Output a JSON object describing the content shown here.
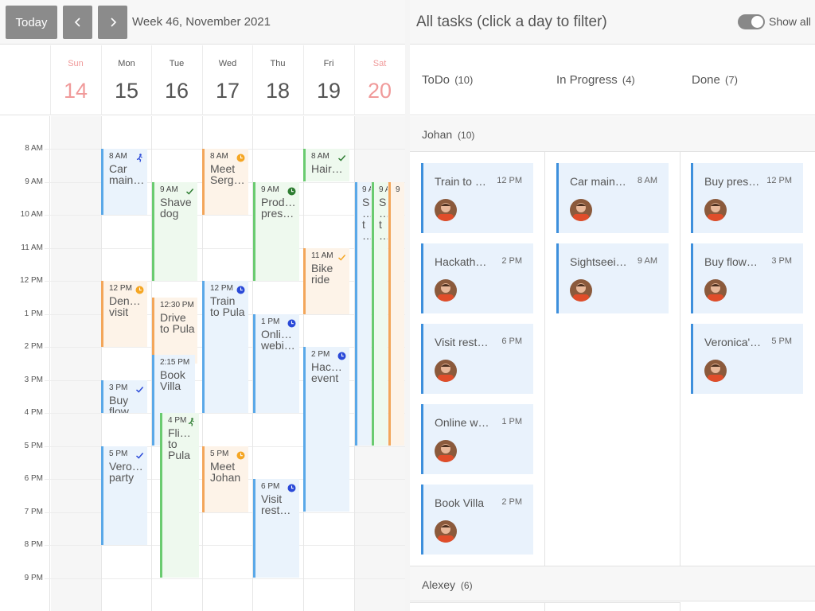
{
  "toolbar": {
    "today_label": "Today",
    "prev_icon": "chevron-left-icon",
    "next_icon": "chevron-right-icon",
    "week_label": "Week 46, November 2021"
  },
  "days": [
    {
      "name": "Sun",
      "num": "14",
      "weekend": true
    },
    {
      "name": "Mon",
      "num": "15",
      "weekend": false
    },
    {
      "name": "Tue",
      "num": "16",
      "weekend": false
    },
    {
      "name": "Wed",
      "num": "17",
      "weekend": false
    },
    {
      "name": "Thu",
      "num": "18",
      "weekend": false
    },
    {
      "name": "Fri",
      "num": "19",
      "weekend": false
    },
    {
      "name": "Sat",
      "num": "20",
      "weekend": true
    }
  ],
  "time_labels": [
    "8 AM",
    "9 AM",
    "10 AM",
    "11 AM",
    "12 PM",
    "1 PM",
    "2 PM",
    "3 PM",
    "4 PM",
    "5 PM",
    "6 PM",
    "7 PM",
    "8 PM",
    "9 PM"
  ],
  "events": {
    "mon_car": {
      "time": "8 AM",
      "title": "Car main…",
      "color": "blue",
      "icon": "running-icon"
    },
    "mon_dentist": {
      "time": "12 PM",
      "title": "Den… visit",
      "color": "orange",
      "icon": "clock-icon"
    },
    "mon_flowers": {
      "time": "3 PM",
      "title": "Buy flow…",
      "color": "blue",
      "icon": "check-icon"
    },
    "mon_party": {
      "time": "5 PM",
      "title": "Vero… party",
      "color": "blue",
      "icon": "check-icon"
    },
    "tue_shave": {
      "time": "9 AM",
      "title": "Shave dog",
      "color": "green",
      "icon": "check-icon"
    },
    "tue_drive": {
      "time": "12:30 PM",
      "title": "Drive to Pula",
      "color": "orange",
      "icon": ""
    },
    "tue_villa": {
      "time": "2:15 PM",
      "title": "Book Villa",
      "color": "blue",
      "icon": ""
    },
    "tue_flight": {
      "time": "4 PM",
      "title": "Fli… to Pula",
      "color": "green",
      "icon": "running-icon"
    },
    "wed_meet_serg": {
      "time": "8 AM",
      "title": "Meet Serg…",
      "color": "orange",
      "icon": "clock-icon"
    },
    "wed_train": {
      "time": "12 PM",
      "title": "Train to Pula",
      "color": "blue",
      "icon": "clock-icon"
    },
    "wed_meet_johan": {
      "time": "5 PM",
      "title": "Meet Johan",
      "color": "orange",
      "icon": "clock-icon"
    },
    "thu_product": {
      "time": "9 AM",
      "title": "Prod… pres…",
      "color": "green",
      "icon": "clock-icon"
    },
    "thu_online": {
      "time": "1 PM",
      "title": "Onli… webi…",
      "color": "blue",
      "icon": "clock-icon"
    },
    "thu_visit": {
      "time": "6 PM",
      "title": "Visit rest…",
      "color": "blue",
      "icon": "clock-icon"
    },
    "fri_hair": {
      "time": "8 AM",
      "title": "Hair…",
      "color": "green",
      "icon": "check-icon"
    },
    "fri_bike": {
      "time": "11 AM",
      "title": "Bike ride",
      "color": "orange",
      "icon": "check-icon"
    },
    "fri_hack": {
      "time": "2 PM",
      "title": "Hac… event",
      "color": "blue",
      "icon": "clock-icon"
    },
    "sat_a": {
      "time": "9 A",
      "title": "S… t…",
      "color": "blue",
      "icon": ""
    },
    "sat_b": {
      "time": "9 A",
      "title": "S… t…",
      "color": "green",
      "icon": ""
    },
    "sat_c": {
      "time": "9",
      "title": "",
      "color": "orange",
      "icon": ""
    }
  },
  "panel": {
    "title": "All tasks (click a day to filter)",
    "show_all_label": "Show all",
    "show_all_on": true,
    "columns": [
      {
        "name": "ToDo",
        "count": "(10)"
      },
      {
        "name": "In Progress",
        "count": "(4)"
      },
      {
        "name": "Done",
        "count": "(7)"
      }
    ],
    "groups": [
      {
        "name": "Johan",
        "count": "(10)"
      },
      {
        "name": "Alexey",
        "count": "(6)"
      }
    ],
    "johan": {
      "todo": [
        {
          "title": "Train to P…",
          "time": "12 PM"
        },
        {
          "title": "Hackatho…",
          "time": "2 PM"
        },
        {
          "title": "Visit resta…",
          "time": "6 PM"
        },
        {
          "title": "Online we…",
          "time": "1 PM"
        },
        {
          "title": "Book Villa",
          "time": "2 PM"
        }
      ],
      "inprogress": [
        {
          "title": "Car maint…",
          "time": "8 AM"
        },
        {
          "title": "Sightseein…",
          "time": "9 AM"
        }
      ],
      "done": [
        {
          "title": "Buy pres…",
          "time": "12 PM"
        },
        {
          "title": "Buy flowers",
          "time": "3 PM"
        },
        {
          "title": "Veronica's…",
          "time": "5 PM"
        }
      ]
    }
  },
  "colors": {
    "accent_blue": "#3d8fdc",
    "event_blue": "#5aa8e8",
    "event_orange": "#f3a65a",
    "event_green": "#6acb70",
    "weekend_red": "#f09a9a",
    "button_gray": "#8b8b8b"
  }
}
